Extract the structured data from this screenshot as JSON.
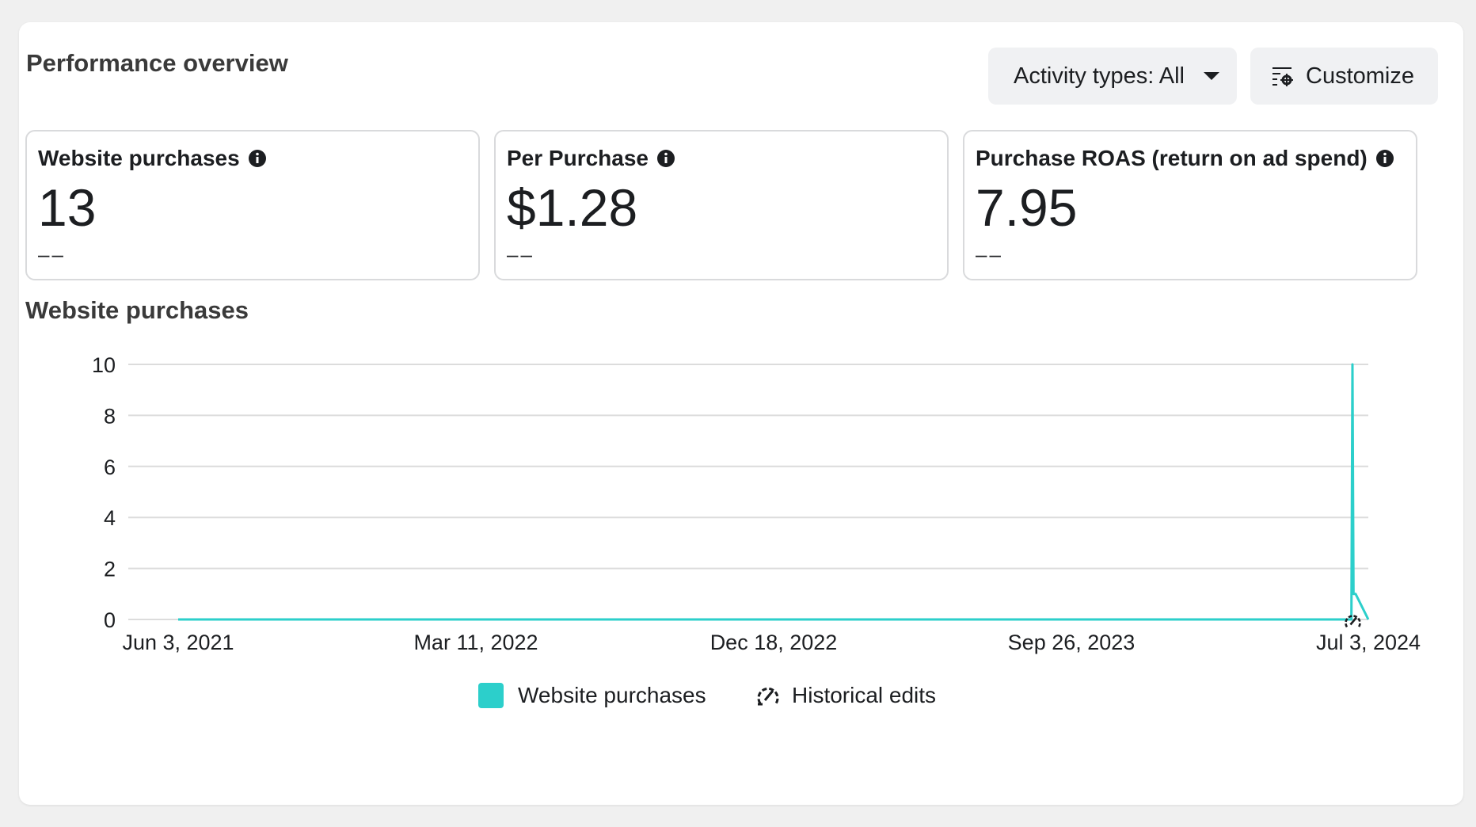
{
  "header": {
    "title": "Performance overview",
    "activity_button": "Activity types: All",
    "customize_button": "Customize"
  },
  "metrics": [
    {
      "label": "Website purchases",
      "value": "13",
      "delta": "––"
    },
    {
      "label": "Per Purchase",
      "value": "$1.28",
      "delta": "––"
    },
    {
      "label": "Purchase ROAS (return on ad spend)",
      "value": "7.95",
      "delta": "––"
    }
  ],
  "chart": {
    "title": "Website purchases",
    "legend": {
      "series": "Website purchases",
      "edits": "Historical edits"
    }
  },
  "colors": {
    "series": "#2ccfcb",
    "grid": "#dcdcdc"
  },
  "icons": [
    "info-icon",
    "caret-down-icon",
    "customize-settings-icon",
    "historical-edits-icon"
  ],
  "chart_data": {
    "type": "line",
    "title": "Website purchases",
    "xlabel": "",
    "ylabel": "",
    "ylim": [
      0,
      10
    ],
    "yticks": [
      0,
      2,
      4,
      6,
      8,
      10
    ],
    "x_tick_labels": [
      "Jun 3, 2021",
      "Mar 11, 2022",
      "Dec 18, 2022",
      "Sep 26, 2023",
      "Jul 3, 2024"
    ],
    "series": [
      {
        "name": "Website purchases",
        "x": [
          "2021-06-03",
          "2024-06-17",
          "2024-06-18",
          "2024-06-19",
          "2024-06-20",
          "2024-06-21",
          "2024-07-03"
        ],
        "values": [
          0,
          0,
          10,
          1,
          1,
          1,
          0
        ]
      }
    ],
    "markers": [
      {
        "type": "historical-edit",
        "x": "2024-06-18"
      }
    ],
    "legend": [
      "Website purchases",
      "Historical edits"
    ],
    "legend_position": "bottom",
    "grid": true
  }
}
